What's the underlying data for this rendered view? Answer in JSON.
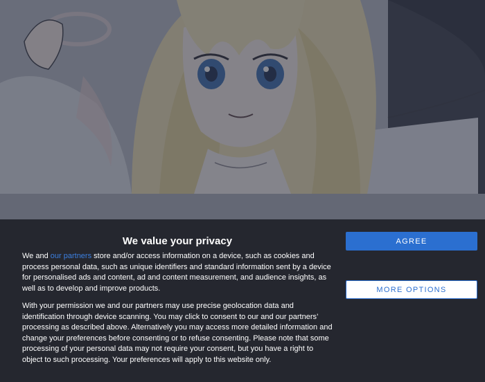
{
  "background": {
    "description_icon": "anime-angel-illustration"
  },
  "consent": {
    "title": "We value your privacy",
    "p1_prefix": "We and ",
    "p1_link": "our partners",
    "p1_rest": " store and/or access information on a device, such as cookies and process personal data, such as unique identifiers and standard information sent by a device for personalised ads and content, ad and content measurement, and audience insights, as well as to develop and improve products.",
    "p2": "With your permission we and our partners may use precise geolocation data and identification through device scanning. You may click to consent to our and our partners’ processing as described above. Alternatively you may access more detailed information and change your preferences before consenting or to refuse consenting. Please note that some processing of your personal data may not require your consent, but you have a right to object to such processing. Your preferences will apply to this website only.",
    "agree_label": "AGREE",
    "more_options_label": "MORE OPTIONS"
  },
  "colors": {
    "banner_bg": "#25272f",
    "accent": "#2b6fd0",
    "link": "#3c7fe0"
  }
}
